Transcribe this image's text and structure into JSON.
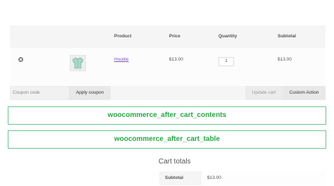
{
  "cart": {
    "headers": {
      "product": "Product",
      "price": "Price",
      "quantity": "Quantity",
      "subtotal": "Subtotal"
    },
    "item": {
      "name": "Hoodie",
      "price": "$13.00",
      "quantity": "1",
      "subtotal": "$13.00",
      "remove_icon": "remove-circle-icon",
      "thumbnail_icon": "hoodie-thumbnail"
    }
  },
  "actions": {
    "coupon_placeholder": "Coupon code",
    "apply_coupon": "Apply coupon",
    "update_cart": "Update cart",
    "custom_action": "Custom Action"
  },
  "hooks": {
    "after_cart_contents": "woocommerce_after_cart_contents",
    "after_cart_table": "woocommerce_after_cart_table"
  },
  "totals": {
    "heading": "Cart totals",
    "subtotal_label": "Subtotal",
    "subtotal_value": "$13.00"
  },
  "colors": {
    "link": "#7f54b3",
    "hook_text": "#28a745",
    "hook_border": "#6cc38c"
  }
}
